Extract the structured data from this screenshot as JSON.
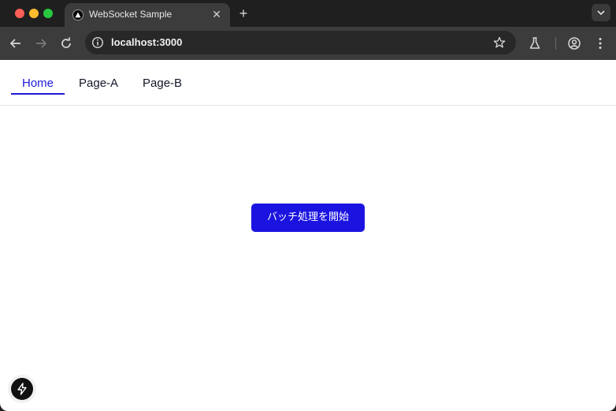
{
  "browser": {
    "tab": {
      "title": "WebSocket Sample",
      "favicon": "nextjs-triangle-icon"
    },
    "address_bar": {
      "url": "localhost:3000"
    },
    "colors": {
      "frame": "#1f1f1f",
      "toolbar": "#3c3c3c",
      "omnibox": "#282828"
    }
  },
  "nav": {
    "items": [
      {
        "label": "Home",
        "active": true
      },
      {
        "label": "Page-A",
        "active": false
      },
      {
        "label": "Page-B",
        "active": false
      }
    ],
    "active_color": "#1d1bd6"
  },
  "main": {
    "batch_button_label": "バッチ処理を開始",
    "button_color": "#1b14e0"
  },
  "icons": {
    "back": "arrow-left-icon",
    "forward": "arrow-right-icon",
    "reload": "reload-icon",
    "info": "info-icon",
    "bookmark": "star-icon",
    "labs": "flask-icon",
    "profile": "profile-icon",
    "menu": "kebab-menu-icon",
    "devtools": "lightning-bolt-icon"
  }
}
